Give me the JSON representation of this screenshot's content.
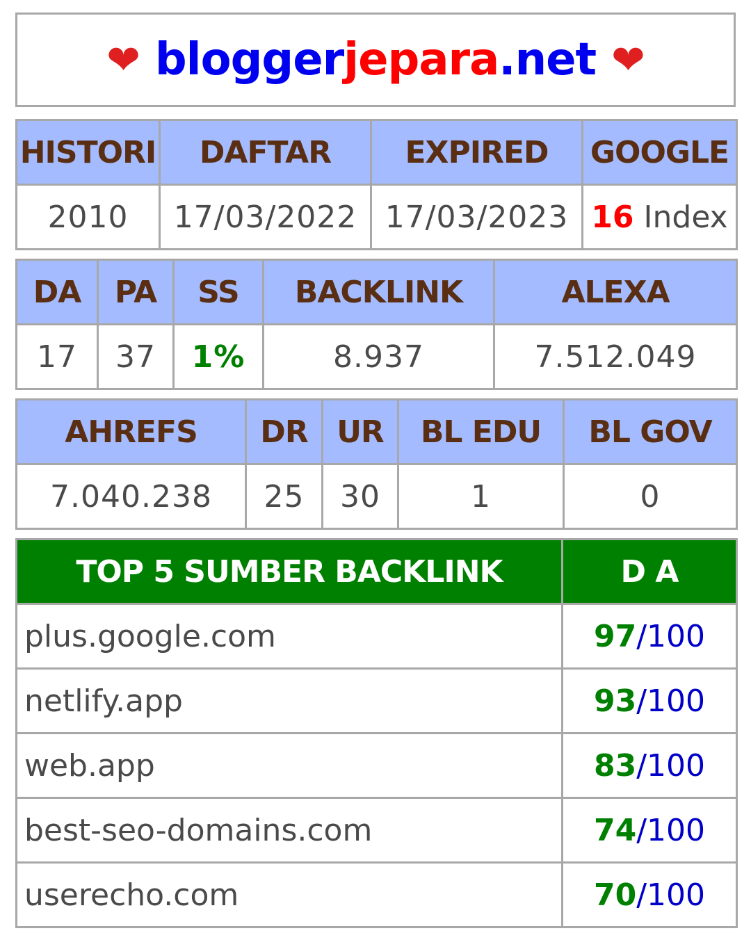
{
  "header": {
    "heart_left": "❤",
    "brand_part1": "blogger",
    "brand_part2": "jepara",
    "brand_part3": ".net",
    "heart_right": "❤"
  },
  "table1": {
    "headers": [
      "HISTORI",
      "DAFTAR",
      "EXPIRED",
      "GOOGLE"
    ],
    "values": {
      "histori": "2010",
      "daftar": "17/03/2022",
      "expired": "17/03/2023",
      "google_count": "16",
      "google_suffix": " Index"
    }
  },
  "table2": {
    "headers": [
      "DA",
      "PA",
      "SS",
      "BACKLINK",
      "ALEXA"
    ],
    "values": [
      "17",
      "37",
      "1%",
      "8.937",
      "7.512.049"
    ]
  },
  "table3": {
    "headers": [
      "AHREFS",
      "DR",
      "UR",
      "BL EDU",
      "BL GOV"
    ],
    "values": [
      "7.040.238",
      "25",
      "30",
      "1",
      "0"
    ]
  },
  "table4": {
    "headers": [
      "TOP 5 SUMBER BACKLINK",
      "D A"
    ],
    "rows": [
      {
        "site": "plus.google.com",
        "score": "97",
        "max": "/100"
      },
      {
        "site": "netlify.app",
        "score": "93",
        "max": "/100"
      },
      {
        "site": "web.app",
        "score": "83",
        "max": "/100"
      },
      {
        "site": "best-seo-domains.com",
        "score": "74",
        "max": "/100"
      },
      {
        "site": "userecho.com",
        "score": "70",
        "max": "/100"
      }
    ]
  },
  "colors": {
    "header_bg": "#a4bcff",
    "header_text": "#5a2e12",
    "top5_bg": "#008000",
    "brand_blue": "#0000f0",
    "brand_red": "#ff0000"
  }
}
